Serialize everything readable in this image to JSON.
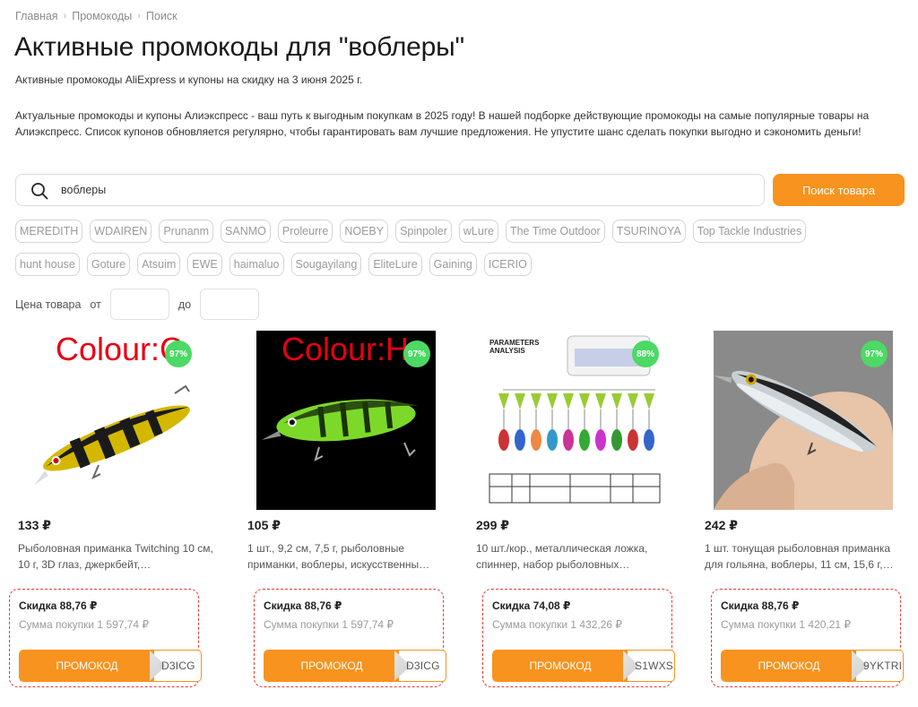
{
  "breadcrumb": [
    "Главная",
    "Промокоды",
    "Поиск"
  ],
  "title": "Активные промокоды для \"воблеры\"",
  "subtitle": "Активные промокоды AliExpress и купоны на скидку на 3 июня 2025 г.",
  "intro": "Актуальные промокоды и купоны Алиэкспресс - ваш путь к выгодным покупкам в 2025 году! В нашей подборке действующие промокоды на самые популярные товары на Алиэкспресс. Список купонов обновляется регулярно, чтобы гарантировать вам лучшие предложения. Не упустите шанс сделать покупки выгодно и сэкономить деньги!",
  "search": {
    "value": "воблеры",
    "button_label": "Поиск товара"
  },
  "tags_row1": [
    "MEREDITH",
    "WDAIREN",
    "Prunanm",
    "SANMO",
    "Proleurre",
    "NOEBY",
    "Spinpoler",
    "wLure",
    "The Time Outdoor",
    "TSURINOYA",
    "Top Tackle Industries"
  ],
  "tags_row2": [
    "hunt house",
    "Goture",
    "Atsuim",
    "EWE",
    "haimaluo",
    "Sougayilang",
    "EliteLure",
    "Gaining",
    "ICERIO"
  ],
  "price_filter": {
    "label": "Цена товара",
    "from": "от",
    "to": "до"
  },
  "colors": {
    "accent": "#f7931e",
    "badge": "#4cd964",
    "promo_border": "#e53935"
  },
  "products": [
    {
      "percent": "97%",
      "overlay": "Colour:C",
      "price": "133 ₽",
      "title": "Рыболовная приманка Twitching 10 см, 10 г, 3D глаз, джеркбейт,…",
      "discount": "Скидка 88,76 ₽",
      "sum": "Сумма покупки 1 597,74 ₽",
      "promo_label": "ПРОМОКОД",
      "code": "D3ICG"
    },
    {
      "percent": "97%",
      "overlay": "Colour:H",
      "price": "105 ₽",
      "title": "1 шт., 9,2 см, 7,5 г, рыболовные приманки, воблеры, искусственны…",
      "discount": "Скидка 88,76 ₽",
      "sum": "Сумма покупки 1 597,74 ₽",
      "promo_label": "ПРОМОКОД",
      "code": "D3ICG"
    },
    {
      "percent": "88%",
      "overlay": "",
      "price": "299 ₽",
      "title": "10 шт./кор., металлическая ложка, спиннер, набор рыболовных…",
      "discount": "Скидка 74,08 ₽",
      "sum": "Сумма покупки 1 432,26 ₽",
      "promo_label": "ПРОМОКОД",
      "code": "S1WXS"
    },
    {
      "percent": "97%",
      "overlay": "",
      "price": "242 ₽",
      "title": "1 шт. тонущая рыболовная приманка для гольяна, воблеры, 11 см, 15,6 г,…",
      "discount": "Скидка 88,76 ₽",
      "sum": "Сумма покупки 1 420,21 ₽",
      "promo_label": "ПРОМОКОД",
      "code": "9YKTRI"
    }
  ]
}
